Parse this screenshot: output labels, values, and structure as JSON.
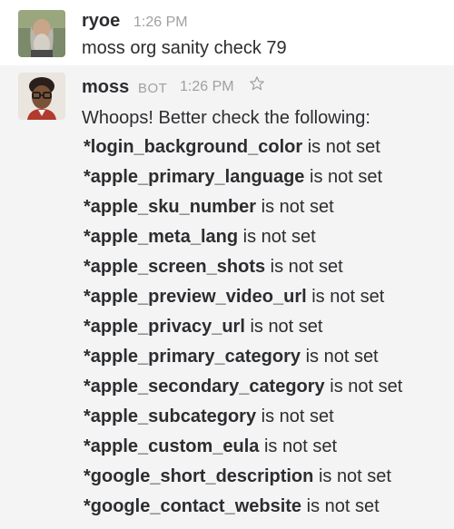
{
  "messages": [
    {
      "author": "ryoe",
      "time": "1:26 PM",
      "text": "moss org sanity check 79"
    },
    {
      "author": "moss",
      "badge": "BOT",
      "time": "1:26 PM",
      "star_icon": "star-outline-icon",
      "intro": "Whoops! Better check the following:",
      "items": [
        {
          "key": "*login_background_color",
          "suffix": "is not set"
        },
        {
          "key": "*apple_primary_language",
          "suffix": "is not set"
        },
        {
          "key": "*apple_sku_number",
          "suffix": "is not set"
        },
        {
          "key": "*apple_meta_lang",
          "suffix": "is not set"
        },
        {
          "key": "*apple_screen_shots",
          "suffix": "is not set"
        },
        {
          "key": "*apple_preview_video_url",
          "suffix": "is not set"
        },
        {
          "key": "*apple_privacy_url",
          "suffix": "is not set"
        },
        {
          "key": "*apple_primary_category",
          "suffix": "is not set"
        },
        {
          "key": "*apple_secondary_category",
          "suffix": "is not set"
        },
        {
          "key": "*apple_subcategory",
          "suffix": "is not set"
        },
        {
          "key": "*apple_custom_eula",
          "suffix": "is not set"
        },
        {
          "key": "*google_short_description",
          "suffix": "is not set"
        },
        {
          "key": "*google_contact_website",
          "suffix": "is not set"
        }
      ]
    }
  ]
}
